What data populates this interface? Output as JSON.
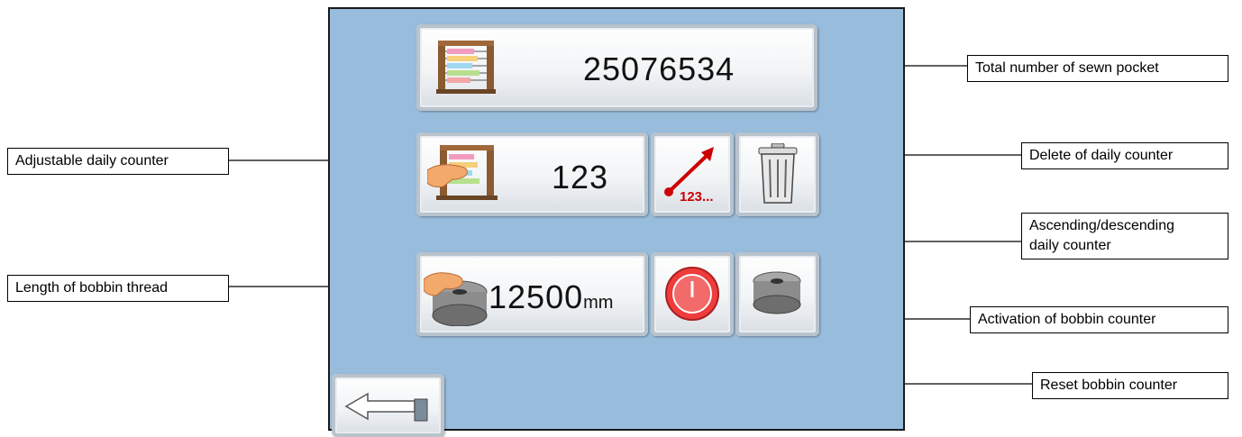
{
  "counters": {
    "total_value": "25076534",
    "daily_value": "123",
    "bobbin_value": "12500",
    "bobbin_unit": "mm",
    "direction_icon_text": "123..."
  },
  "callouts": {
    "total": "Total number of sewn pocket",
    "daily": "Adjustable daily counter",
    "delete": "Delete of daily counter",
    "ascending_line1": "Ascending/descending",
    "ascending_line2": "daily counter",
    "length": "Length of bobbin thread",
    "activation": "Activation of bobbin counter",
    "reset": "Reset bobbin counter"
  },
  "icons": {
    "total": "abacus-icon",
    "daily": "hand-abacus-icon",
    "direction": "ascending-arrow-icon",
    "delete": "trash-can-icon",
    "bobbin_length": "hand-bobbin-icon",
    "reset": "power-reset-icon",
    "activation": "bobbin-icon",
    "back": "back-arrow-icon"
  },
  "colors": {
    "panel": "#98bcdc",
    "reset_button": "#ee3c3c",
    "arrow": "#cc0000"
  }
}
